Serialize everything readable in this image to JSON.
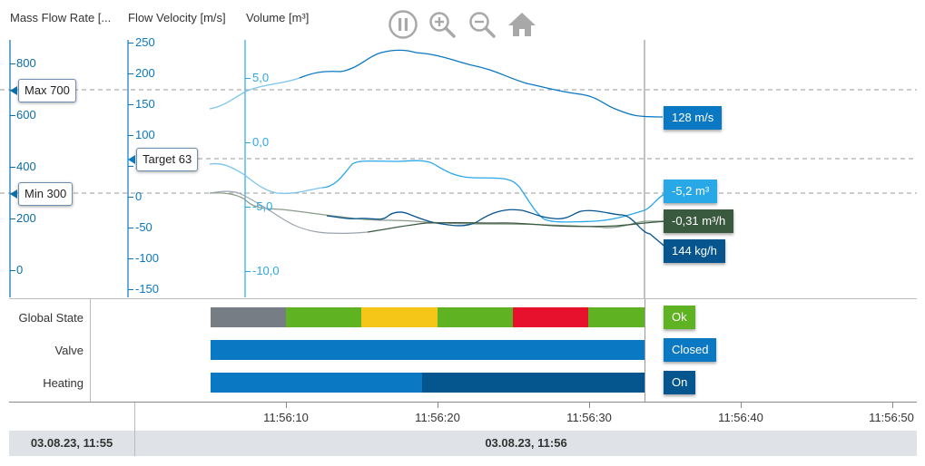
{
  "axes": {
    "mass_flow": {
      "title": "Mass Flow Rate [...",
      "ticks": [
        "800",
        "600",
        "400",
        "200",
        "0"
      ]
    },
    "flow_velocity": {
      "title": "Flow Velocity [m/s]",
      "ticks": [
        "250",
        "200",
        "150",
        "100",
        "50",
        "0",
        "-50",
        "-100",
        "-150"
      ]
    },
    "volume": {
      "title": "Volume [m³]",
      "ticks": [
        "5,0",
        "0,0",
        "-5,0",
        "-10,0"
      ]
    }
  },
  "toolbar": {
    "pause": "pause-button",
    "zoom_in": "zoom-in-button",
    "zoom_out": "zoom-out-button",
    "home": "home-button"
  },
  "markers": {
    "max": "Max 700",
    "target": "Target 63",
    "min": "Min 300"
  },
  "value_labels": {
    "velocity": "128 m/s",
    "volume": "-5,2 m³",
    "volume_rate": "-0,31 m³/h",
    "mass_flow": "144 kg/h"
  },
  "states": {
    "rows": [
      {
        "label": "Global State",
        "value": "Ok"
      },
      {
        "label": "Valve",
        "value": "Closed"
      },
      {
        "label": "Heating",
        "value": "On"
      }
    ]
  },
  "time_axis": {
    "ticks": [
      "11:56:10",
      "11:56:20",
      "11:56:30",
      "11:56:40",
      "11:56:50"
    ],
    "dates": [
      "03.08.23, 11:55",
      "03.08.23, 11:56"
    ]
  },
  "colors": {
    "velocity": "#0a78c2",
    "volume": "#29a8e8",
    "volume_rate": "#3a5a40",
    "mass_flow": "#06558f",
    "ok_green": "#5fb221",
    "warn_yellow": "#f5c518",
    "alarm_red": "#e8112d",
    "idle_gray": "#777d85",
    "valve_blue": "#0a78c2",
    "heating_dark": "#05558f"
  }
}
